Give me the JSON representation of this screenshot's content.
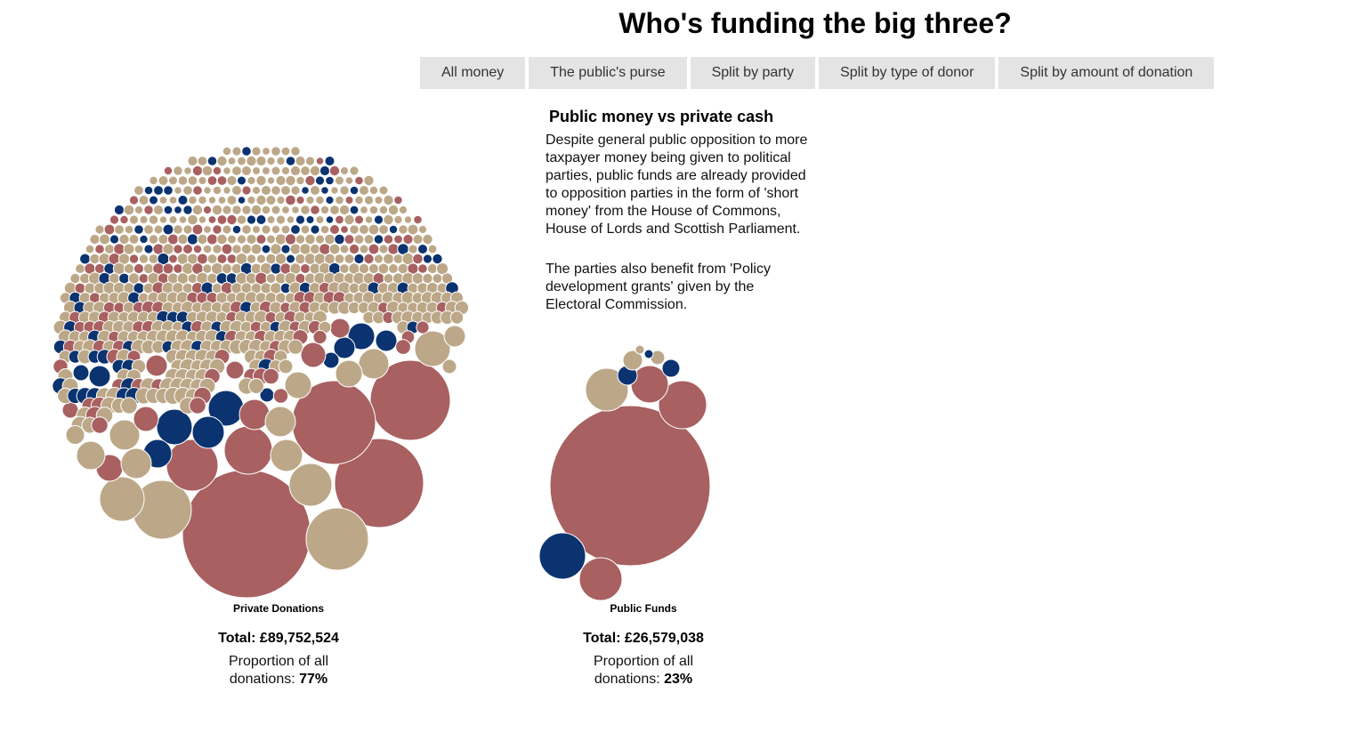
{
  "title": "Who's funding the big three?",
  "tabs": [
    {
      "label": "All money"
    },
    {
      "label": "The public's purse"
    },
    {
      "label": "Split by party"
    },
    {
      "label": "Split by type of donor"
    },
    {
      "label": "Split by amount of donation"
    }
  ],
  "panel": {
    "heading": "Public money vs private cash",
    "paragraphs": [
      "Despite general public opposition to more taxpayer money being given to political parties, public funds are already provided to opposition parties in the form of 'short money' from the House of Commons, House of Lords and Scottish Parliament.",
      "The parties also benefit from 'Policy development grants' given by the Electoral Commission."
    ]
  },
  "colors": {
    "labour": "#a86061",
    "conservative": "#0b3370",
    "libdem": "#bca888"
  },
  "chart_data": {
    "type": "bubble",
    "groups": [
      {
        "label": "Private Donations",
        "total_text": "Total: £89,752,524",
        "proportion_prefix": "Proportion of all donations:",
        "proportion_value": "77%",
        "total": 89752524,
        "proportion_percent": 77
      },
      {
        "label": "Public Funds",
        "total_text": "Total: £26,579,038",
        "proportion_prefix": "Proportion of all donations:",
        "proportion_value": "23%",
        "total": 26579038,
        "proportion_percent": 23
      }
    ]
  }
}
